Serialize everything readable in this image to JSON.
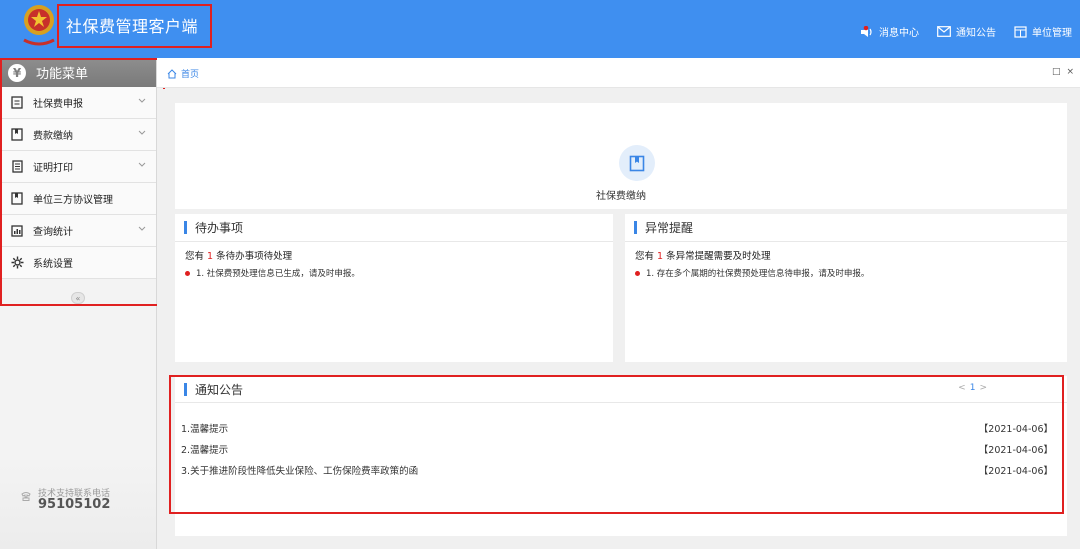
{
  "header": {
    "app_title": "社保费管理客户端",
    "nav": [
      {
        "label": "消息中心",
        "icon": "speaker-icon"
      },
      {
        "label": "通知公告",
        "icon": "mail-icon"
      },
      {
        "label": "单位管理",
        "icon": "building-icon"
      }
    ],
    "window_control": "□"
  },
  "sidebar": {
    "header": "功能菜单",
    "header_icon": "¥",
    "items": [
      {
        "label": "社保费申报",
        "icon": "form-icon",
        "expandable": true
      },
      {
        "label": "费款缴纳",
        "icon": "book-icon",
        "expandable": true
      },
      {
        "label": "证明打印",
        "icon": "document-icon",
        "expandable": true
      },
      {
        "label": "单位三方协议管理",
        "icon": "book-icon",
        "expandable": false
      },
      {
        "label": "查询统计",
        "icon": "chart-icon",
        "expandable": true
      },
      {
        "label": "系统设置",
        "icon": "gear-icon",
        "expandable": false
      }
    ],
    "collapse_label": "«",
    "support": {
      "label": "技术支持联系电话",
      "number": "95105102"
    }
  },
  "breadcrumb": {
    "label": "首页",
    "controls": [
      "□",
      "×"
    ]
  },
  "quick": {
    "label": "社保费缴纳"
  },
  "todo": {
    "title": "待办事项",
    "summary_pre": "您有",
    "count": "1",
    "summary_post": "条待办事项待处理",
    "items": [
      "1. 社保费预处理信息已生成，请及时申报。"
    ]
  },
  "alert": {
    "title": "异常提醒",
    "summary_pre": "您有",
    "count": "1",
    "summary_post": "条异常提醒需要及时处理",
    "items": [
      "1. 存在多个属期的社保费预处理信息待申报，请及时申报。"
    ]
  },
  "notice": {
    "title": "通知公告",
    "pager": {
      "prev": "<",
      "page": "1",
      "next": ">"
    },
    "items": [
      {
        "title": "1.温馨提示",
        "date": "【2021-04-06】"
      },
      {
        "title": "2.温馨提示",
        "date": "【2021-04-06】"
      },
      {
        "title": "3.关于推进阶段性降低失业保险、工伤保险费率政策的函",
        "date": "【2021-04-06】"
      }
    ]
  },
  "colors": {
    "header_blue": "#3f8ff0",
    "accent_blue": "#3a86e6",
    "highlight_red": "#e02020"
  }
}
